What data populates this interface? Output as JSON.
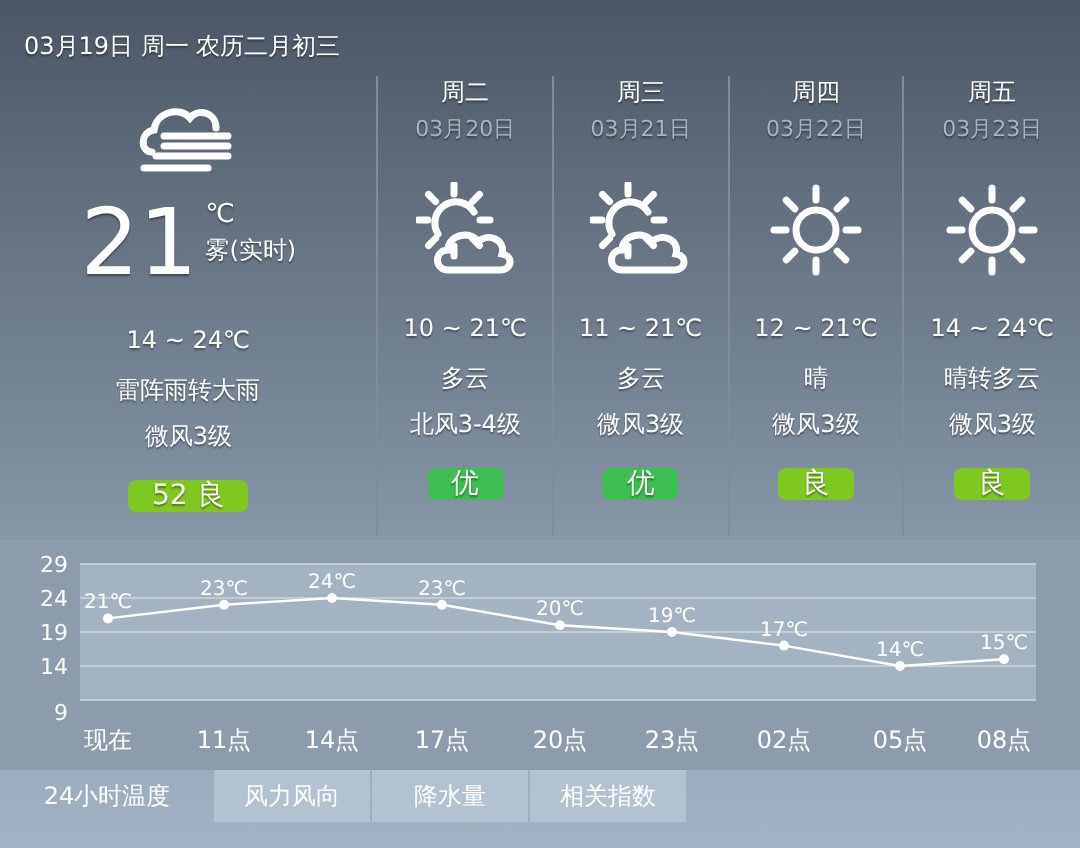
{
  "header": {
    "date": "03月19日 周一 农历二月初三"
  },
  "current": {
    "kind": "fog",
    "temp": "21",
    "unit": "℃",
    "desc": "雾(实时)",
    "range": "14 ~ 24℃",
    "weather": "雷阵雨转大雨",
    "wind": "微风3级",
    "aqi": {
      "label": "52 良",
      "color": "#7ec820"
    }
  },
  "forecast": [
    {
      "weekday": "周二",
      "date": "03月20日",
      "kind": "partly_cloudy",
      "range": "10 ~ 21℃",
      "weather": "多云",
      "wind": "北风3-4级",
      "aqi": {
        "label": "优",
        "color": "#3cbe50"
      }
    },
    {
      "weekday": "周三",
      "date": "03月21日",
      "kind": "partly_cloudy",
      "range": "11 ~ 21℃",
      "weather": "多云",
      "wind": "微风3级",
      "aqi": {
        "label": "优",
        "color": "#3cbe50"
      }
    },
    {
      "weekday": "周四",
      "date": "03月22日",
      "kind": "sunny",
      "range": "12 ~ 21℃",
      "weather": "晴",
      "wind": "微风3级",
      "aqi": {
        "label": "良",
        "color": "#7ec820"
      }
    },
    {
      "weekday": "周五",
      "date": "03月23日",
      "kind": "sunny",
      "range": "14 ~ 24℃",
      "weather": "晴转多云",
      "wind": "微风3级",
      "aqi": {
        "label": "良",
        "color": "#7ec820"
      }
    }
  ],
  "chart": {
    "chart_data": {
      "type": "line",
      "categories": [
        "现在",
        "11点",
        "14点",
        "17点",
        "20点",
        "23点",
        "02点",
        "05点",
        "08点"
      ],
      "series": [
        {
          "color": "#ffffff",
          "marker": "circle",
          "values": [
            21,
            23,
            24,
            23,
            20,
            19,
            17,
            14,
            15
          ]
        }
      ],
      "ylim": [
        9,
        29
      ],
      "yticks": [
        9,
        14,
        19,
        24,
        29
      ],
      "grid": true,
      "value_labels": [
        "21℃",
        "23℃",
        "24℃",
        "23℃",
        "20℃",
        "19℃",
        "17℃",
        "14℃",
        "15℃"
      ]
    }
  },
  "tabs": [
    {
      "label": "24小时温度",
      "selected": true
    },
    {
      "label": "风力风向",
      "selected": false
    },
    {
      "label": "降水量",
      "selected": false
    },
    {
      "label": "相关指数",
      "selected": false
    }
  ]
}
